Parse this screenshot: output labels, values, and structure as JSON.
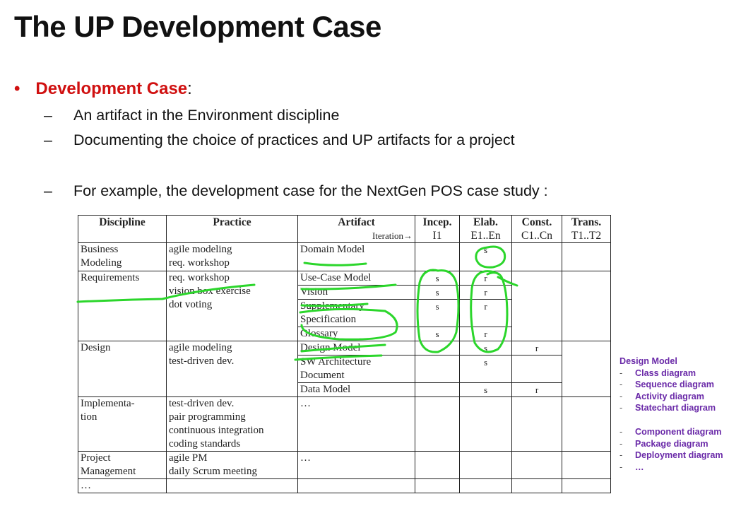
{
  "slide": {
    "title": "The UP Development Case",
    "bullet": {
      "term": "Development Case",
      "suffix": ":"
    },
    "sub_points": [
      "An artifact in the Environment discipline",
      "Documenting the choice of practices and UP artifacts for a project",
      "For example, the development case for the NextGen POS case study :"
    ],
    "dash": "–",
    "bullet_glyph": "•"
  },
  "table": {
    "headers": {
      "discipline": "Discipline",
      "practice": "Practice",
      "artifact": "Artifact",
      "iteration": "Iteration→",
      "incep": "Incep.",
      "incep_iter": "I1",
      "elab": "Elab.",
      "elab_iter": "E1..En",
      "const": "Const.",
      "const_iter": "C1..Cn",
      "trans": "Trans.",
      "trans_iter": "T1..T2"
    },
    "rows": {
      "business": {
        "discipline": [
          "Business",
          "Modeling"
        ],
        "practice": [
          "agile modeling",
          "req. workshop"
        ],
        "artifact": "Domain Model",
        "elab": "s"
      },
      "req": {
        "discipline": "Requirements",
        "practice": [
          "req. workshop",
          "vision box exercise",
          "dot voting"
        ],
        "artifacts": [
          {
            "name": [
              "Use-Case Model"
            ],
            "incep": "s",
            "elab": "r"
          },
          {
            "name": [
              "Vision"
            ],
            "incep": "s",
            "elab": "r"
          },
          {
            "name": [
              "Supplementary",
              "Specification"
            ],
            "incep": "s",
            "elab": "r"
          },
          {
            "name": [
              "Glossary"
            ],
            "incep": "s",
            "elab": "r"
          }
        ]
      },
      "design": {
        "discipline": "Design",
        "practice": [
          "agile modeling",
          "test-driven dev."
        ],
        "artifacts": [
          {
            "name": [
              "Design Model"
            ],
            "elab": "s",
            "const": "r"
          },
          {
            "name": [
              "SW Architecture",
              "Document"
            ],
            "elab": "s",
            "const": ""
          },
          {
            "name": [
              "Data Model"
            ],
            "elab": "s",
            "const": "r"
          }
        ]
      },
      "impl": {
        "discipline": [
          "Implementa-",
          "tion"
        ],
        "practice": [
          "test-driven dev.",
          "pair programming",
          "continuous integration",
          "coding standards"
        ],
        "artifact": "…"
      },
      "pm": {
        "discipline": [
          "Project",
          "Management"
        ],
        "practice": [
          "agile PM",
          "daily Scrum meeting"
        ],
        "artifact": "…"
      },
      "more": {
        "discipline": "…"
      }
    }
  },
  "notes": {
    "title": "Design Model",
    "dash": "-",
    "items_a": [
      "Class diagram",
      "Sequence diagram",
      "Activity diagram",
      "Statechart diagram"
    ],
    "items_b": [
      "Component diagram",
      "Package diagram",
      "Deployment diagram",
      "…"
    ]
  },
  "colors": {
    "accent_red": "#d01010",
    "note_purple": "#6a2aa8",
    "ink_green": "#2bd62b"
  }
}
